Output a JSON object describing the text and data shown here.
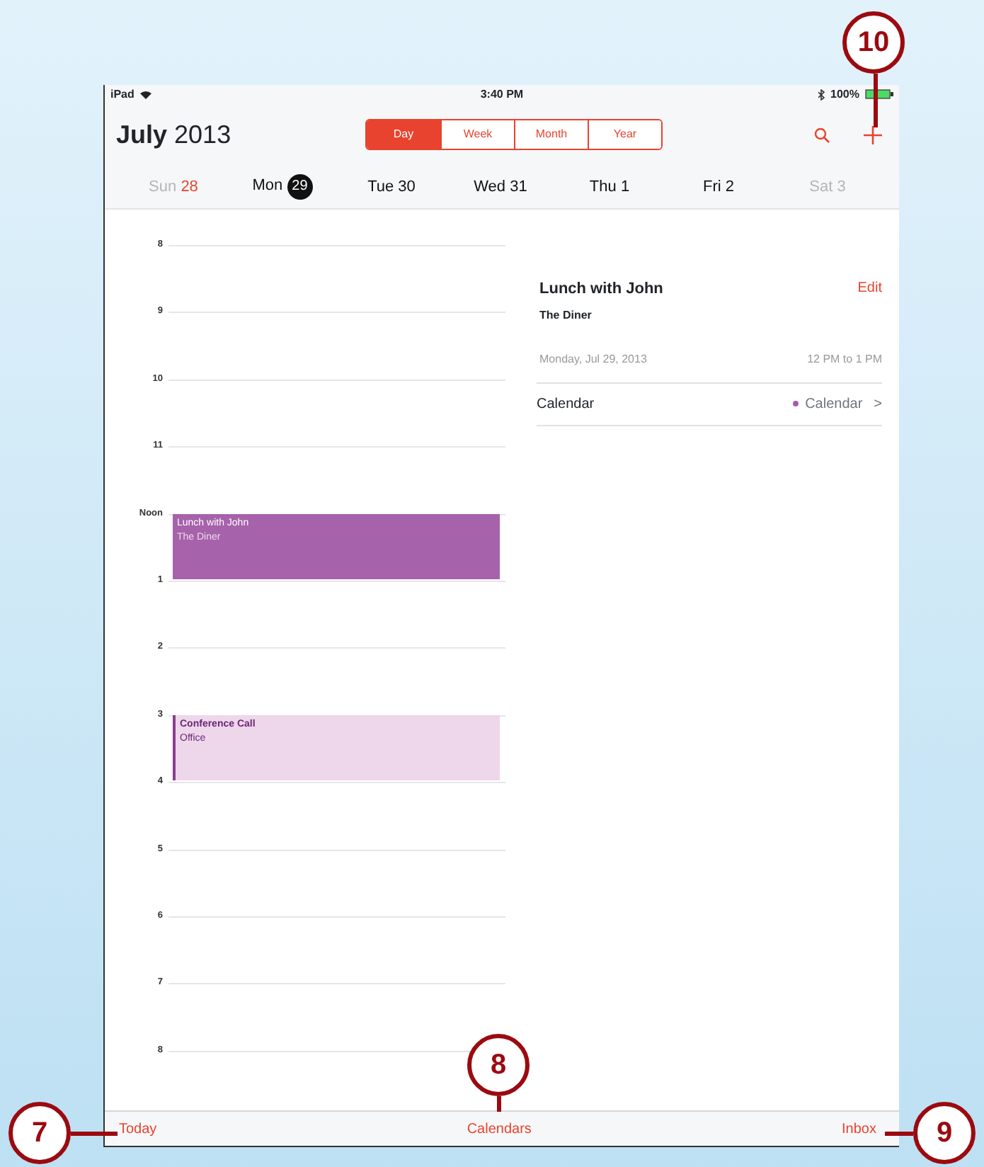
{
  "status_bar": {
    "device": "iPad",
    "time": "3:40 PM",
    "battery": "100%"
  },
  "header": {
    "title": "**July** 2013",
    "view_tabs": [
      {
        "label": "Day",
        "selected": true
      },
      {
        "label": "Week",
        "selected": false
      },
      {
        "label": "Month",
        "selected": false
      },
      {
        "label": "Year",
        "selected": false
      }
    ]
  },
  "days": [
    {
      "weekday": "Sun",
      "date": "28",
      "dimmed": true,
      "today": true,
      "selected": false
    },
    {
      "weekday": "Mon",
      "date": "29",
      "dimmed": false,
      "today": false,
      "selected": true
    },
    {
      "weekday": "Tue",
      "date": "30",
      "dimmed": false,
      "today": false,
      "selected": false
    },
    {
      "weekday": "Wed",
      "date": "31",
      "dimmed": false,
      "today": false,
      "selected": false
    },
    {
      "weekday": "Thu",
      "date": "1",
      "dimmed": false,
      "today": false,
      "selected": false
    },
    {
      "weekday": "Fri",
      "date": "2",
      "dimmed": false,
      "today": false,
      "selected": false
    },
    {
      "weekday": "Sat",
      "date": "3",
      "dimmed": true,
      "today": false,
      "selected": false
    }
  ],
  "hours": [
    {
      "label": "8"
    },
    {
      "label": "9"
    },
    {
      "label": "10"
    },
    {
      "label": "11"
    },
    {
      "label": "Noon",
      "events": [
        {
          "title": "Lunch with John",
          "location": "The Diner",
          "selected": true
        }
      ]
    },
    {
      "label": "1"
    },
    {
      "label": "2"
    },
    {
      "label": "3",
      "events": [
        {
          "title": "Conference Call",
          "location": "Office",
          "selected": false
        }
      ]
    },
    {
      "label": "4"
    },
    {
      "label": "5"
    },
    {
      "label": "6"
    },
    {
      "label": "7"
    },
    {
      "label": "8"
    }
  ],
  "detail": {
    "title": "Lunch with John",
    "location": "The Diner",
    "edit": "Edit",
    "date": "Monday, Jul 29, 2013",
    "time": "12 PM to 1 PM",
    "calendar_label": "Calendar",
    "calendar_value": "Calendar",
    "chevron": ">"
  },
  "toolbar": [
    "Today",
    "Calendars",
    "Inbox"
  ],
  "callouts": [
    {
      "number": "10",
      "kind": "down"
    },
    {
      "number": "8",
      "kind": "down"
    },
    {
      "number": "7",
      "kind": "right"
    },
    {
      "number": "9",
      "kind": "left"
    }
  ]
}
